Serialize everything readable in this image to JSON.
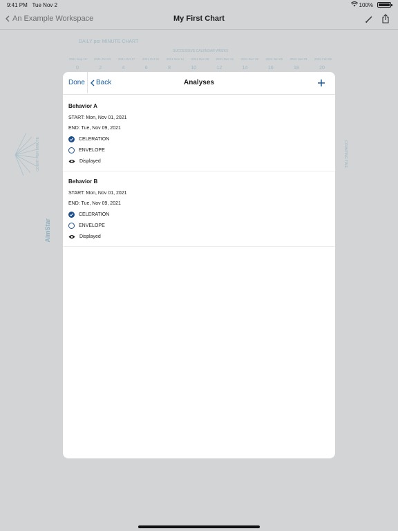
{
  "status_bar": {
    "time": "9:41 PM",
    "date": "Tue Nov 2",
    "battery": "100%"
  },
  "nav": {
    "back_label": "An Example Workspace",
    "title": "My First Chart",
    "icons": [
      "pencil-icon",
      "share-icon"
    ]
  },
  "chart_bg": {
    "title": "DAILY per MINUTE CHART",
    "subtitle": "SUCCESSIVE CALENDAR WEEKS",
    "dates": [
      "2021 Sep 19",
      "2021 Oct 03",
      "2021 Oct 17",
      "2021 Oct 31",
      "2021 Nov 14",
      "2021 Nov 28",
      "2021 Dec 12",
      "2021 Dec 26",
      "2022 Jan 09",
      "2022 Jan 23",
      "2022 Feb 06"
    ],
    "week_numbers": [
      "0",
      "2",
      "4",
      "6",
      "8",
      "10",
      "12",
      "14",
      "16",
      "18",
      "20"
    ],
    "left_axis": "COUNT PER MINUTE",
    "right_axis": "COUNTING TIME",
    "logo": "AimStar"
  },
  "modal": {
    "done_label": "Done",
    "back_label": "Back",
    "title": "Analyses",
    "add_icon": "plus-icon",
    "behaviors": [
      {
        "name": "Behavior A",
        "start": "START: Mon, Nov 01, 2021",
        "end": "END: Tue, Nov 09, 2021",
        "celeration": "CELERATION",
        "envelope": "ENVELOPE",
        "displayed": "Displayed",
        "celeration_checked": true
      },
      {
        "name": "Behavior B",
        "start": "START: Mon, Nov 01, 2021",
        "end": "END: Tue, Nov 09, 2021",
        "celeration": "CELERATION",
        "envelope": "ENVELOPE",
        "displayed": "Displayed",
        "celeration_checked": true
      }
    ]
  },
  "colors": {
    "accent": "#1c5a9c",
    "background": "#d3d4d5",
    "chart_faded": "#9fb9c4"
  }
}
